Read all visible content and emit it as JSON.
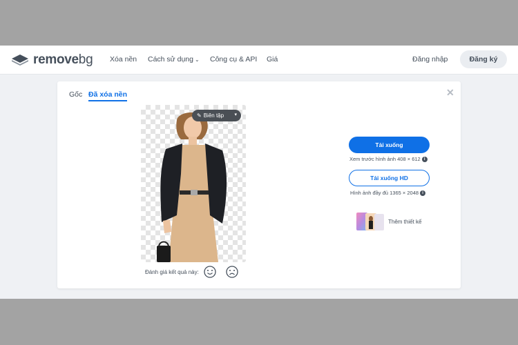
{
  "brand": {
    "name": "remove",
    "name_suffix": "bg"
  },
  "nav": {
    "items": [
      {
        "label": "Xóa nền"
      },
      {
        "label": "Cách sử dụng"
      },
      {
        "label": "Công cụ & API"
      },
      {
        "label": "Giá"
      }
    ],
    "login_label": "Đăng nhập",
    "signup_label": "Đăng ký"
  },
  "tabs": [
    {
      "label": "Gốc"
    },
    {
      "label": "Đã xóa nền",
      "active": true
    }
  ],
  "editor": {
    "edit_label": "Biên tập"
  },
  "rating": {
    "label": "Đánh giá kết quả này:"
  },
  "download": {
    "button_label": "Tải xuống",
    "preview_note": "Xem trước hình ảnh 408 × 612",
    "hd_button_label": "Tải xuống HD",
    "hd_note": "Hình ảnh đầy đủ 1365 × 2048"
  },
  "design": {
    "label": "Thêm thiết kế"
  },
  "colors": {
    "accent": "#0f70e6",
    "text": "#454f5b",
    "page_bg": "#eff1f4"
  }
}
